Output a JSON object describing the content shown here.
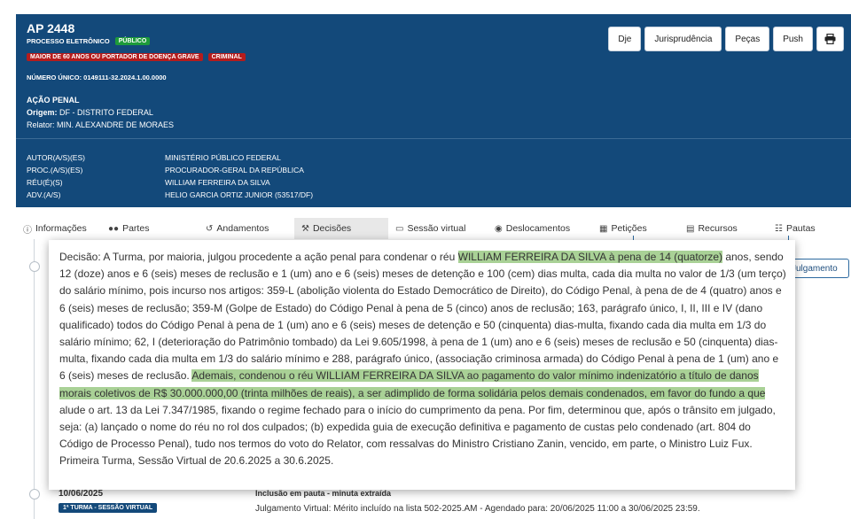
{
  "header": {
    "title": "AP 2448",
    "process_type": "PROCESSO ELETRÔNICO",
    "badge_public": "PÚBLICO",
    "badge_priority": "MAIOR DE 60 ANOS OU PORTADOR DE DOENÇA GRAVE",
    "badge_criminal": "CRIMINAL",
    "unique_number": "NÚMERO ÚNICO: 0149111-32.2024.1.00.0000",
    "class": "AÇÃO PENAL",
    "origin_label": "Origem:",
    "origin_value": "DF - DISTRITO FEDERAL",
    "rapporteur": "Relator: MIN. ALEXANDRE DE MORAES",
    "parties": [
      {
        "role": "AUTOR(A/S)(ES)",
        "name": "MINISTÉRIO PÚBLICO FEDERAL"
      },
      {
        "role": "PROC.(A/S)(ES)",
        "name": "PROCURADOR-GERAL DA REPÚBLICA"
      },
      {
        "role": "RÉU(É)(S)",
        "name": "WILLIAM FERREIRA DA SILVA"
      },
      {
        "role": "ADV.(A/S)",
        "name": "HELIO GARCIA ORTIZ JUNIOR (53517/DF)"
      }
    ]
  },
  "toolbar": {
    "dje": "Dje",
    "jurisprudencia": "Jurisprudência",
    "pecas": "Peças",
    "push": "Push",
    "print_icon": "printer-icon"
  },
  "tabs": [
    {
      "label": "Informações",
      "icon": "info-icon"
    },
    {
      "label": "Partes",
      "icon": "users-icon"
    },
    {
      "label": "Andamentos",
      "icon": "history-icon"
    },
    {
      "label": "Decisões",
      "icon": "gavel-icon",
      "active": true
    },
    {
      "label": "Sessão virtual",
      "icon": "monitor-icon"
    },
    {
      "label": "Deslocamentos",
      "icon": "map-marker-icon"
    },
    {
      "label": "Petições",
      "icon": "folder-icon"
    },
    {
      "label": "Recursos",
      "icon": "document-icon"
    },
    {
      "label": "Pautas",
      "icon": "calendar-icon"
    }
  ],
  "side_button": "Julgamento",
  "decision": {
    "part1": "Decisão: A Turma, por maioria, julgou procedente a ação penal para condenar o réu ",
    "hl1": "WILLIAM FERREIRA DA SILVA à pena de 14 (quatorze)",
    "part2": " anos, sendo 12 (doze) anos e 6 (seis) meses de reclusão e 1 (um) ano e 6 (seis) meses de detenção e 100 (cem) dias multa, cada dia multa no valor de 1/3 (um terço) do salário mínimo, pois incurso nos artigos: 359-L (abolição violenta do Estado Democrático de Direito), do Código Penal, à pena de de 4 (quatro) anos e 6 (seis) meses de reclusão; 359-M (Golpe de Estado) do Código Penal à pena de 5 (cinco) anos de reclusão; 163, parágrafo único, I, II, III e IV (dano qualificado) todos do Código Penal à pena de 1 (um) ano e 6 (seis) meses de detenção e 50 (cinquenta) dias-multa, fixando cada dia multa em 1/3 do salário mínimo; 62, I (deterioração do Patrimônio tombado) da Lei 9.605/1998, à pena de 1 (um) ano e 6 (seis) meses de reclusão e 50 (cinquenta) dias-multa, fixando cada dia multa em 1/3 do salário mínimo e 288, parágrafo único, (associação criminosa armada) do Código Penal à pena de 1 (um) ano e 6 (seis) meses de reclusão. ",
    "hl2": "Ademais, condenou o réu WILLIAM FERREIRA DA SILVA ao pagamento do valor mínimo indenizatório a título de danos morais coletivos de R$ 30.000.000,00 (trinta milhões de reais), a ser adimplido de forma solidária pelos demais condenados, em favor do fundo a que",
    "part3": " alude o art. 13 da Lei 7.347/1985, fixando o regime fechado para o início do cumprimento da pena. Por fim, determinou que, após o trânsito em julgado, seja: (a) lançado o nome do réu no rol dos culpados; (b) expedida guia de execução definitiva e pagamento de custas pelo condenado (art. 804 do Código de Processo Penal), tudo nos termos do voto do Relator, com ressalvas do Ministro Cristiano Zanin, vencido, em parte, o Ministro Luiz Fux. Primeira Turma, Sessão Virtual de 20.6.2025 a 30.6.2025."
  },
  "below_entry": {
    "date": "10/06/2025",
    "badge": "1ª TURMA - SESSÃO VIRTUAL",
    "line1": "Inclusão em pauta - minuta extraída",
    "line2": "Julgamento Virtual: Mérito incluído na lista 502-2025.AM - Agendado para: 20/06/2025 11:00 a 30/06/2025 23:59."
  }
}
